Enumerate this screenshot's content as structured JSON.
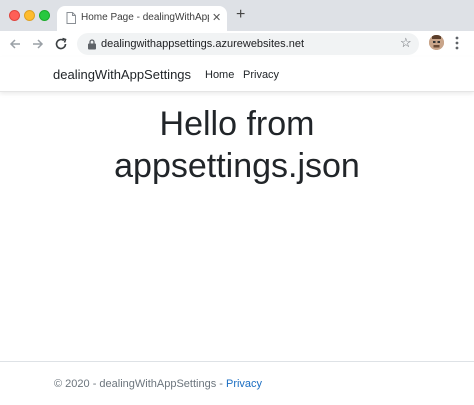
{
  "browser": {
    "tab_title": "Home Page - dealingWithAppS",
    "tab_close": "✕",
    "new_tab": "+",
    "url": "dealingwithappsettings.azurewebsites.net",
    "star": "☆"
  },
  "site": {
    "brand": "dealingWithAppSettings",
    "nav": [
      "Home",
      "Privacy"
    ]
  },
  "main": {
    "heading_line1": "Hello from",
    "heading_line2": "appsettings.json"
  },
  "footer": {
    "text": "© 2020 - dealingWithAppSettings - ",
    "link": "Privacy"
  },
  "colors": {
    "link": "#1b6ec2",
    "tabstrip": "#dee1e6"
  }
}
